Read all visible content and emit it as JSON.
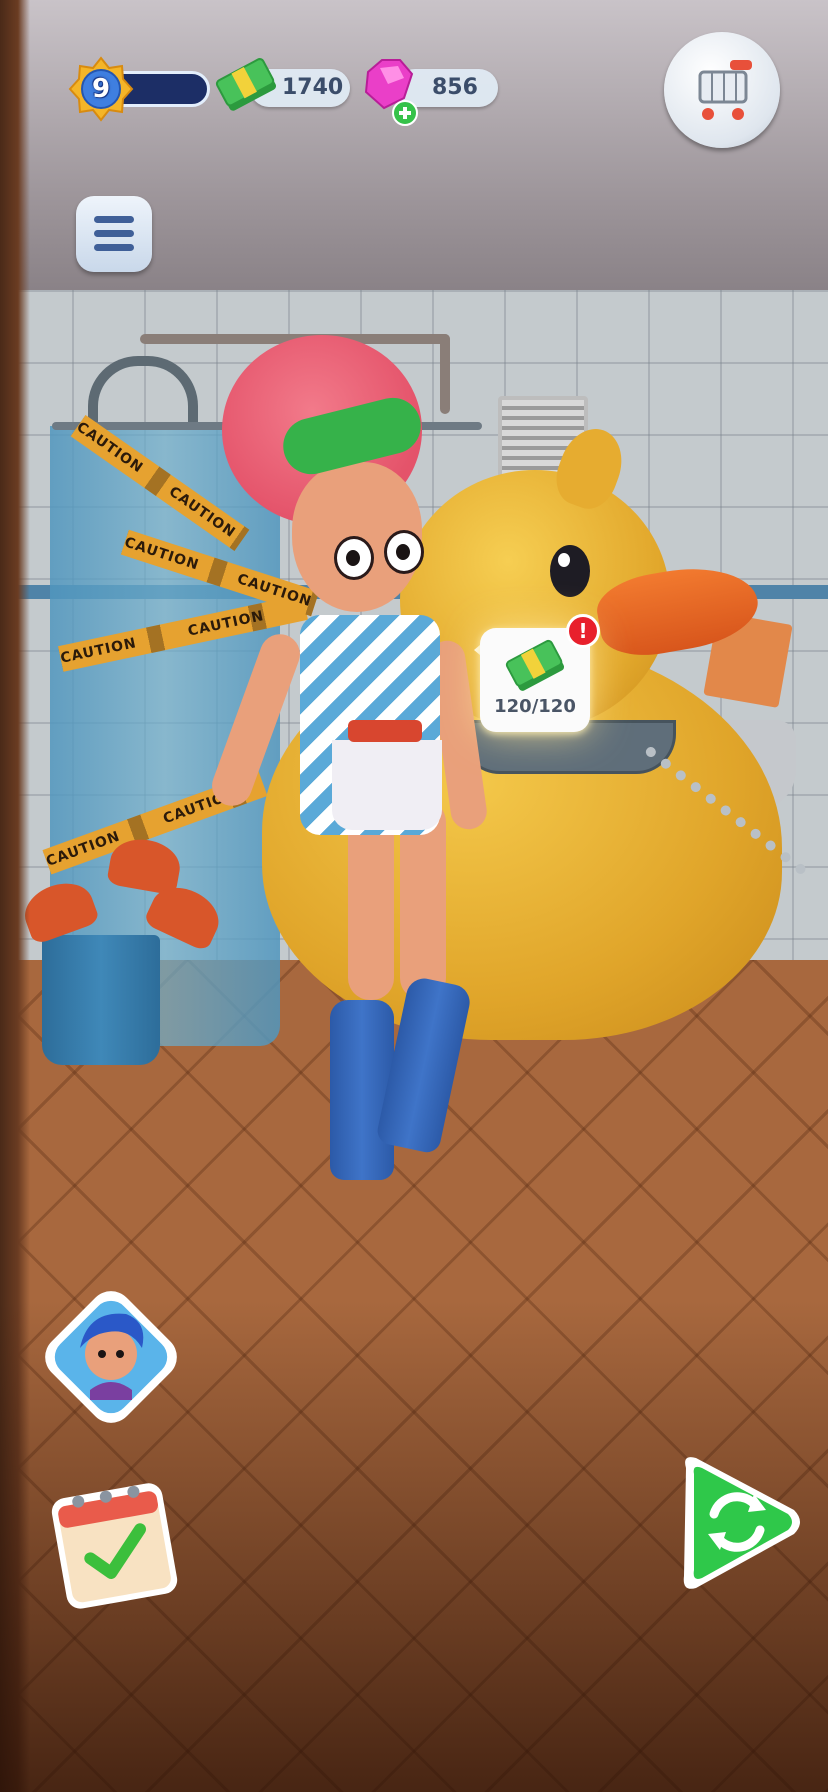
{
  "hud": {
    "level": "9",
    "cash": "1740",
    "gems": "856"
  },
  "quest_bubble": {
    "progress_text": "120/120",
    "alert_mark": "!"
  },
  "scene_text": {
    "caution": "CAUTION"
  },
  "icons": {
    "level": "star-badge-icon",
    "cash": "cash-stack-icon",
    "gems": "pink-gem-icon",
    "gems_add": "plus-icon",
    "shop": "shopping-cart-icon",
    "menu": "hamburger-menu-icon",
    "character": "character-portrait-icon",
    "tasks": "calendar-checkmark-icon",
    "swap": "refresh-arrows-icon"
  },
  "colors": {
    "level_bar": "#1c2e66",
    "alert": "#e8202c",
    "swap_button": "#2fc84a",
    "menu_button": "#3f5f98"
  }
}
